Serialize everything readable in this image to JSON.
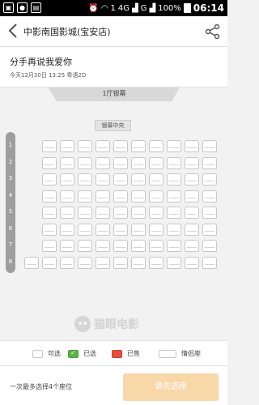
{
  "status_bar": {
    "time": "06:14",
    "battery": "100%",
    "network": "4G",
    "sim": "1",
    "data": "G"
  },
  "header": {
    "title": "中影南国影城(宝安店)"
  },
  "movie": {
    "title": "分手再说我爱你",
    "showtime": "今天12月30日  13:25  粤语2D"
  },
  "hall": {
    "screen_label": "1厅银幕",
    "center_label": "银幕中央",
    "rows": [
      "1",
      "2",
      "3",
      "4",
      "5",
      "6",
      "7",
      "8"
    ],
    "seats_per_row": [
      10,
      10,
      10,
      10,
      10,
      10,
      10,
      11
    ]
  },
  "watermark": "猫眼电影",
  "legend": {
    "available": "可选",
    "selected": "已选",
    "sold": "已售",
    "couple": "情侣座",
    "colors": {
      "selected": "#5ab24a",
      "sold": "#e74c3c"
    }
  },
  "bottom": {
    "limit_text": "一次最多选择4个座位",
    "confirm_label": "请先选座",
    "confirm_color": "#f8d7a8"
  }
}
